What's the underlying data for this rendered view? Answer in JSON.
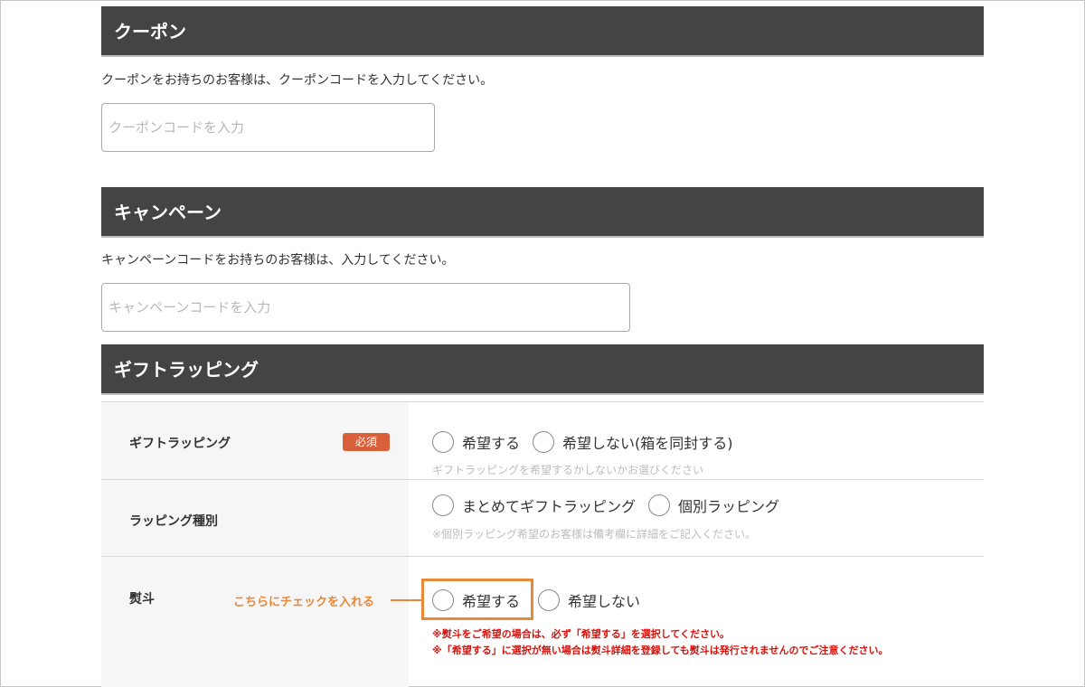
{
  "coupon": {
    "header": "クーポン",
    "description": "クーポンをお持ちのお客様は、クーポンコードを入力してください。",
    "input_placeholder": "クーポンコードを入力",
    "input_value": ""
  },
  "campaign": {
    "header": "キャンペーン",
    "description": "キャンペーンコードをお持ちのお客様は、入力してください。",
    "input_placeholder": "キャンペーンコードを入力",
    "input_value": ""
  },
  "gift": {
    "header": "ギフトラッピング",
    "rows": [
      {
        "label": "ギフトラッピング",
        "badge": "必須",
        "options": [
          "希望する",
          "希望しない(箱を同封する)"
        ],
        "hint": "ギフトラッピングを希望するかしないかお選びください"
      },
      {
        "label": "ラッピング種別",
        "options": [
          "まとめてギフトラッピング",
          "個別ラッピング"
        ],
        "hint": "※個別ラッピング希望のお客様は備考欄に詳細をご記入ください。"
      },
      {
        "label": "熨斗",
        "options": [
          "希望する",
          "希望しない"
        ],
        "warnings": [
          "※熨斗をご希望の場合は、必ず「希望する」を選択してください。",
          "※「希望する」に選択が無い場合は熨斗詳細を登録しても熨斗は発行されませんのでご注意ください。"
        ]
      }
    ]
  },
  "annotation": {
    "callout": "こちらにチェックを入れる",
    "highlight_color": "#e8883a"
  },
  "colors": {
    "header_bg": "#444444",
    "required_badge": "#d9603b",
    "warning_text": "#d6120c",
    "label_cell_bg": "#f6f6f6"
  }
}
